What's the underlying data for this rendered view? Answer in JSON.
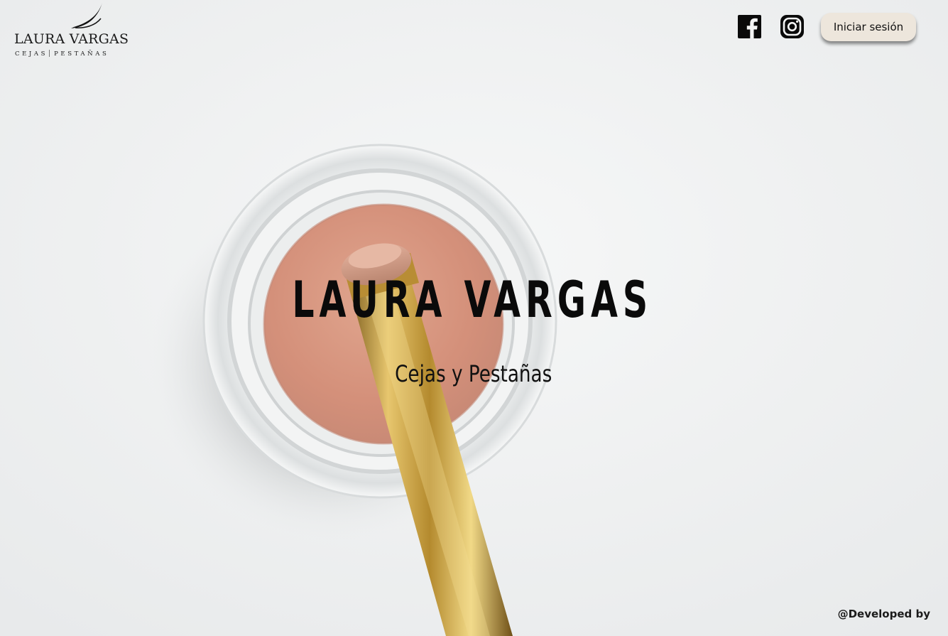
{
  "logo": {
    "name": "LAURA VARGAS",
    "tagline_left": "CEJAS",
    "tagline_right": "PESTAÑAS"
  },
  "header": {
    "social": [
      {
        "icon": "facebook-icon"
      },
      {
        "icon": "instagram-icon"
      }
    ],
    "login_label": "Iniciar sesión"
  },
  "hero": {
    "title": "LAURA VARGAS",
    "subtitle": "Cejas y Pestañas",
    "background": "makeup-powder-jar-with-brush-photo"
  },
  "footer": {
    "credit": "@Developed by"
  },
  "colors": {
    "background": "#eef0f1",
    "powder": "#d99a83",
    "brush_gold": "#c9a24a",
    "button_bg": "#ede6dc",
    "text": "#0a0a0a"
  }
}
